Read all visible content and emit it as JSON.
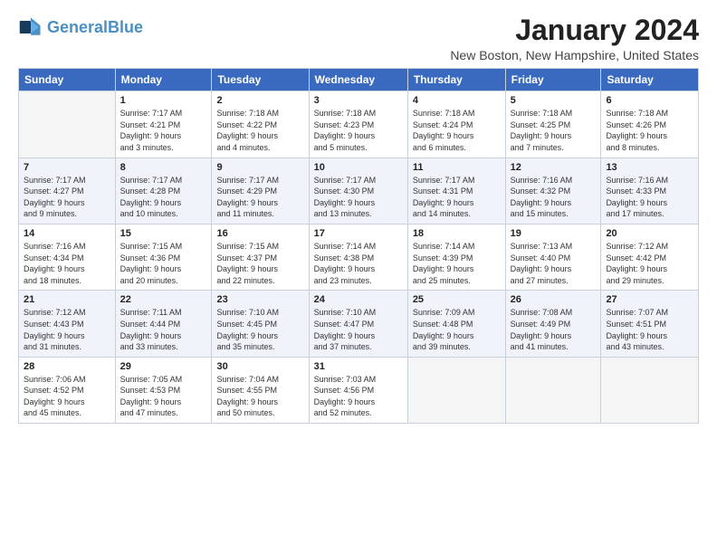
{
  "header": {
    "logo_general": "General",
    "logo_blue": "Blue",
    "month_title": "January 2024",
    "location": "New Boston, New Hampshire, United States"
  },
  "days_of_week": [
    "Sunday",
    "Monday",
    "Tuesday",
    "Wednesday",
    "Thursday",
    "Friday",
    "Saturday"
  ],
  "weeks": [
    [
      {
        "day": "",
        "content": ""
      },
      {
        "day": "1",
        "content": "Sunrise: 7:17 AM\nSunset: 4:21 PM\nDaylight: 9 hours\nand 3 minutes."
      },
      {
        "day": "2",
        "content": "Sunrise: 7:18 AM\nSunset: 4:22 PM\nDaylight: 9 hours\nand 4 minutes."
      },
      {
        "day": "3",
        "content": "Sunrise: 7:18 AM\nSunset: 4:23 PM\nDaylight: 9 hours\nand 5 minutes."
      },
      {
        "day": "4",
        "content": "Sunrise: 7:18 AM\nSunset: 4:24 PM\nDaylight: 9 hours\nand 6 minutes."
      },
      {
        "day": "5",
        "content": "Sunrise: 7:18 AM\nSunset: 4:25 PM\nDaylight: 9 hours\nand 7 minutes."
      },
      {
        "day": "6",
        "content": "Sunrise: 7:18 AM\nSunset: 4:26 PM\nDaylight: 9 hours\nand 8 minutes."
      }
    ],
    [
      {
        "day": "7",
        "content": "Sunrise: 7:17 AM\nSunset: 4:27 PM\nDaylight: 9 hours\nand 9 minutes."
      },
      {
        "day": "8",
        "content": "Sunrise: 7:17 AM\nSunset: 4:28 PM\nDaylight: 9 hours\nand 10 minutes."
      },
      {
        "day": "9",
        "content": "Sunrise: 7:17 AM\nSunset: 4:29 PM\nDaylight: 9 hours\nand 11 minutes."
      },
      {
        "day": "10",
        "content": "Sunrise: 7:17 AM\nSunset: 4:30 PM\nDaylight: 9 hours\nand 13 minutes."
      },
      {
        "day": "11",
        "content": "Sunrise: 7:17 AM\nSunset: 4:31 PM\nDaylight: 9 hours\nand 14 minutes."
      },
      {
        "day": "12",
        "content": "Sunrise: 7:16 AM\nSunset: 4:32 PM\nDaylight: 9 hours\nand 15 minutes."
      },
      {
        "day": "13",
        "content": "Sunrise: 7:16 AM\nSunset: 4:33 PM\nDaylight: 9 hours\nand 17 minutes."
      }
    ],
    [
      {
        "day": "14",
        "content": "Sunrise: 7:16 AM\nSunset: 4:34 PM\nDaylight: 9 hours\nand 18 minutes."
      },
      {
        "day": "15",
        "content": "Sunrise: 7:15 AM\nSunset: 4:36 PM\nDaylight: 9 hours\nand 20 minutes."
      },
      {
        "day": "16",
        "content": "Sunrise: 7:15 AM\nSunset: 4:37 PM\nDaylight: 9 hours\nand 22 minutes."
      },
      {
        "day": "17",
        "content": "Sunrise: 7:14 AM\nSunset: 4:38 PM\nDaylight: 9 hours\nand 23 minutes."
      },
      {
        "day": "18",
        "content": "Sunrise: 7:14 AM\nSunset: 4:39 PM\nDaylight: 9 hours\nand 25 minutes."
      },
      {
        "day": "19",
        "content": "Sunrise: 7:13 AM\nSunset: 4:40 PM\nDaylight: 9 hours\nand 27 minutes."
      },
      {
        "day": "20",
        "content": "Sunrise: 7:12 AM\nSunset: 4:42 PM\nDaylight: 9 hours\nand 29 minutes."
      }
    ],
    [
      {
        "day": "21",
        "content": "Sunrise: 7:12 AM\nSunset: 4:43 PM\nDaylight: 9 hours\nand 31 minutes."
      },
      {
        "day": "22",
        "content": "Sunrise: 7:11 AM\nSunset: 4:44 PM\nDaylight: 9 hours\nand 33 minutes."
      },
      {
        "day": "23",
        "content": "Sunrise: 7:10 AM\nSunset: 4:45 PM\nDaylight: 9 hours\nand 35 minutes."
      },
      {
        "day": "24",
        "content": "Sunrise: 7:10 AM\nSunset: 4:47 PM\nDaylight: 9 hours\nand 37 minutes."
      },
      {
        "day": "25",
        "content": "Sunrise: 7:09 AM\nSunset: 4:48 PM\nDaylight: 9 hours\nand 39 minutes."
      },
      {
        "day": "26",
        "content": "Sunrise: 7:08 AM\nSunset: 4:49 PM\nDaylight: 9 hours\nand 41 minutes."
      },
      {
        "day": "27",
        "content": "Sunrise: 7:07 AM\nSunset: 4:51 PM\nDaylight: 9 hours\nand 43 minutes."
      }
    ],
    [
      {
        "day": "28",
        "content": "Sunrise: 7:06 AM\nSunset: 4:52 PM\nDaylight: 9 hours\nand 45 minutes."
      },
      {
        "day": "29",
        "content": "Sunrise: 7:05 AM\nSunset: 4:53 PM\nDaylight: 9 hours\nand 47 minutes."
      },
      {
        "day": "30",
        "content": "Sunrise: 7:04 AM\nSunset: 4:55 PM\nDaylight: 9 hours\nand 50 minutes."
      },
      {
        "day": "31",
        "content": "Sunrise: 7:03 AM\nSunset: 4:56 PM\nDaylight: 9 hours\nand 52 minutes."
      },
      {
        "day": "",
        "content": ""
      },
      {
        "day": "",
        "content": ""
      },
      {
        "day": "",
        "content": ""
      }
    ]
  ]
}
